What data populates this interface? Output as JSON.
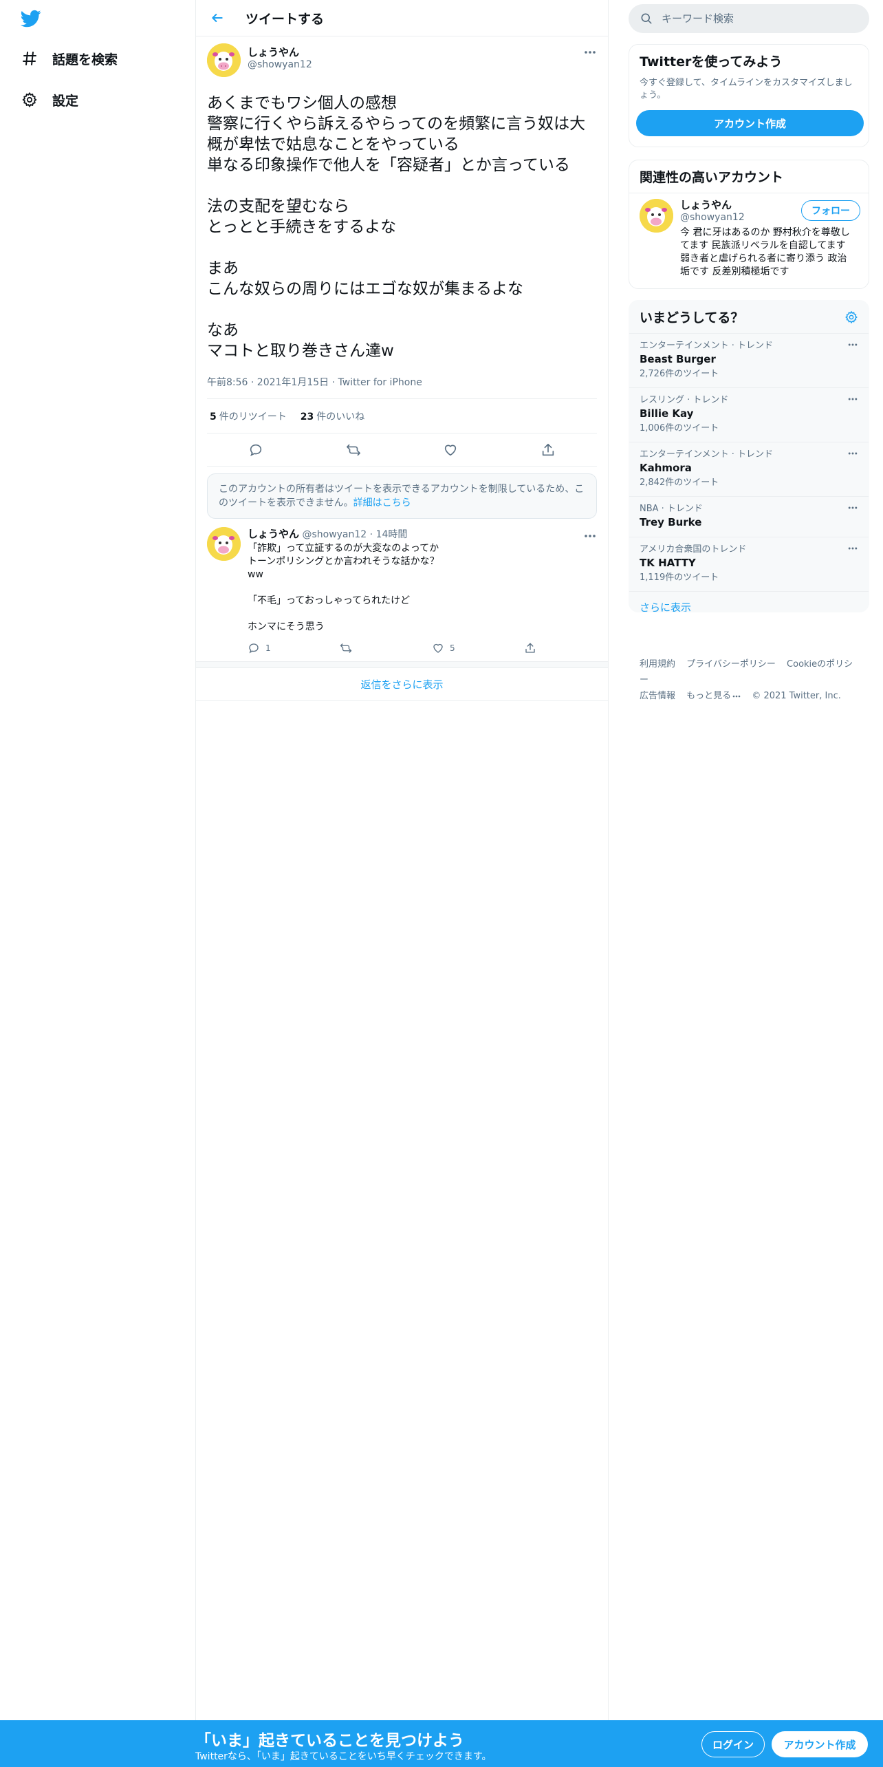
{
  "nav": {
    "items": [
      {
        "label": "話題を検索",
        "icon": "hashtag-icon"
      },
      {
        "label": "設定",
        "icon": "gear-icon"
      }
    ]
  },
  "header": {
    "title": "ツイートする"
  },
  "tweet": {
    "name": "しょうやん",
    "handle": "@showyan12",
    "body": "あくまでもワシ個人の感想\n警察に行くやら訴えるやらってのを頻繁に言う奴は大概が卑怯で姑息なことをやっている\n単なる印象操作で他人を「容疑者」とか言っている\n\n法の支配を望むなら\nとっとと手続きをするよな\n\nまあ\nこんな奴らの周りにはエゴな奴が集まるよな\n\nなあ\nマコトと取り巻きさん達w",
    "meta": "午前8:56 · 2021年1月15日 · Twitter for iPhone",
    "retweets": "5",
    "retweets_label": "件のリツイート",
    "likes": "23",
    "likes_label": "件のいいね"
  },
  "notice": {
    "text": "このアカウントの所有者はツイートを表示できるアカウントを制限しているため、このツイートを表示できません。",
    "link": "詳細はこちら"
  },
  "reply": {
    "name": "しょうやん",
    "handle": "@showyan12",
    "time": "· 14時間",
    "body": "「詐欺」って立証するのが大変なのよってか\nトーンポリシングとか言われそうな話かな？ww\n\n「不毛」っておっしゃってられたけど\n\nホンマにそう思う",
    "replies": "1",
    "likes": "5"
  },
  "show_more_replies": "返信をさらに表示",
  "search": {
    "placeholder": "キーワード検索"
  },
  "signup_card": {
    "title": "Twitterを使ってみよう",
    "text": "今すぐ登録して、タイムラインをカスタマイズしましょう。",
    "button": "アカウント作成"
  },
  "related": {
    "title": "関連性の高いアカウント",
    "name": "しょうやん",
    "handle": "@showyan12",
    "bio": "今 君に牙はあるのか 野村秋介を尊敬してます 民族派リベラルを自認してます 弱き者と虐げられる者に寄り添う 政治垢です 反差別積極垢です",
    "follow": "フォロー"
  },
  "trends": {
    "title": "いまどうしてる？",
    "items": [
      {
        "category": "エンターテインメント · トレンド",
        "name": "Beast Burger",
        "count": "2,726件のツイート"
      },
      {
        "category": "レスリング · トレンド",
        "name": "Billie Kay",
        "count": "1,006件のツイート"
      },
      {
        "category": "エンターテインメント · トレンド",
        "name": "Kahmora",
        "count": "2,842件のツイート"
      },
      {
        "category": "NBA · トレンド",
        "name": "Trey Burke",
        "count": ""
      },
      {
        "category": "アメリカ合衆国のトレンド",
        "name": "TK HATTY",
        "count": "1,119件のツイート"
      }
    ],
    "more": "さらに表示"
  },
  "footer": {
    "terms": "利用規約",
    "privacy": "プライバシーポリシー",
    "cookie": "Cookieのポリシー",
    "ads": "広告情報",
    "more": "もっと見る",
    "copyright": "© 2021 Twitter, Inc."
  },
  "banner": {
    "title": "「いま」起きていることを見つけよう",
    "subtitle": "Twitterなら、「いま」起きていることをいち早くチェックできます。",
    "login": "ログイン",
    "signup": "アカウント作成"
  },
  "colors": {
    "accent": "#1da1f2",
    "text": "#0f1419",
    "muted": "#5b7083"
  }
}
